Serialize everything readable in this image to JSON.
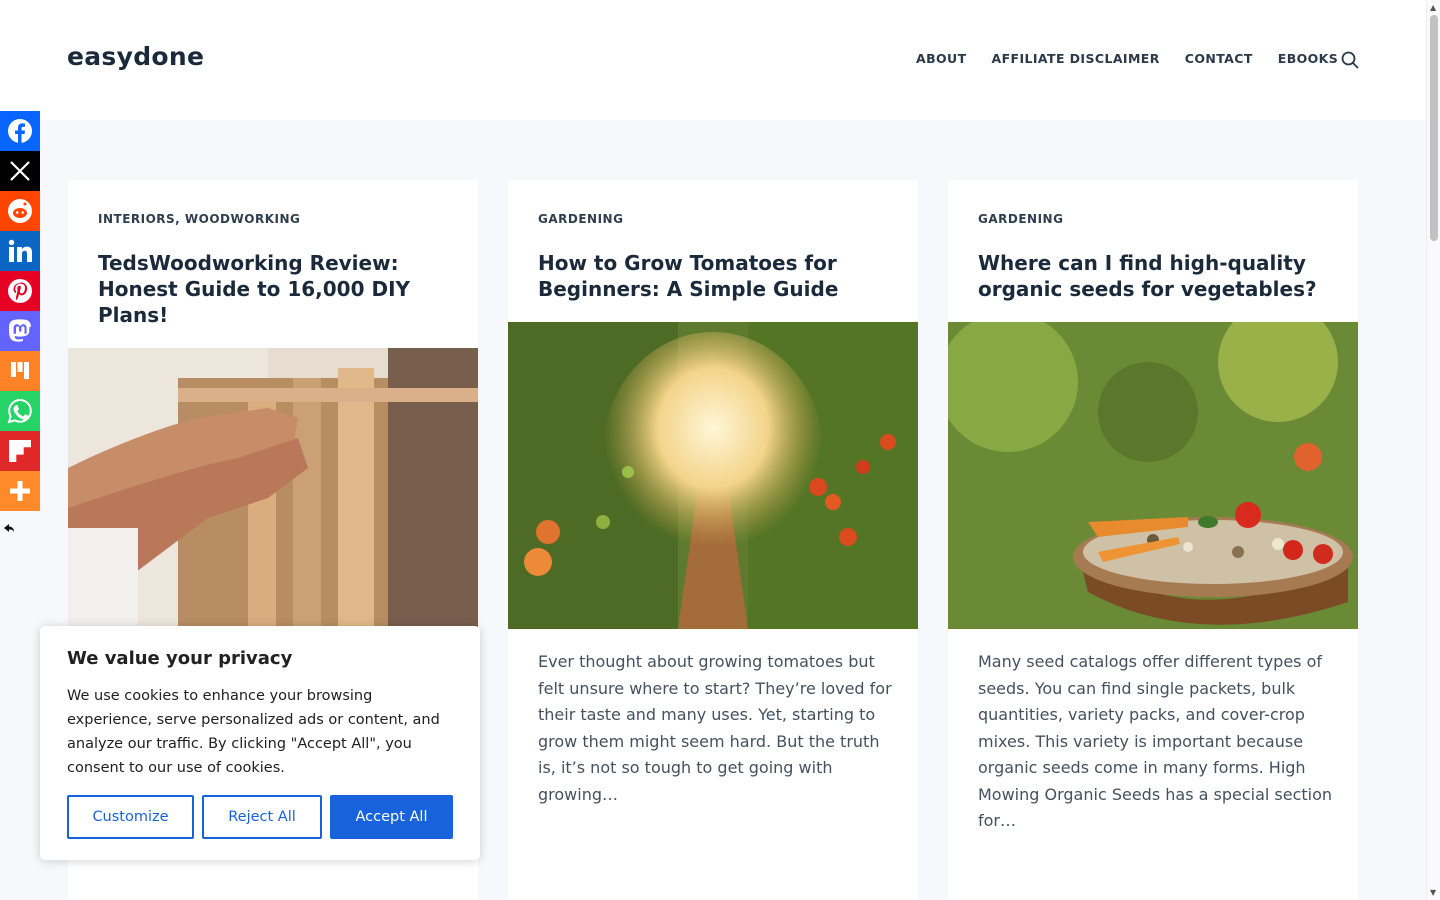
{
  "site": {
    "logo": "easydone"
  },
  "nav": {
    "items": [
      "ABOUT",
      "AFFILIATE DISCLAIMER",
      "CONTACT",
      "EBOOKS"
    ]
  },
  "social": {
    "items": [
      {
        "name": "facebook",
        "color": "#0866ff"
      },
      {
        "name": "x",
        "color": "#000000"
      },
      {
        "name": "reddit",
        "color": "#ff4500"
      },
      {
        "name": "linkedin",
        "color": "#0a66c2"
      },
      {
        "name": "pinterest",
        "color": "#e60023"
      },
      {
        "name": "mastodon",
        "color": "#6364ff"
      },
      {
        "name": "mix",
        "color": "#ff8226"
      },
      {
        "name": "whatsapp",
        "color": "#25d366"
      },
      {
        "name": "flipboard",
        "color": "#e12828"
      },
      {
        "name": "more",
        "color": "#ff8a2a"
      }
    ]
  },
  "cards": [
    {
      "category": "INTERIORS, WOODWORKING",
      "title": "TedsWoodworking Review: Honest Guide to 16,000 DIY Plans!",
      "excerpt": ""
    },
    {
      "category": "GARDENING",
      "title": "How to Grow Tomatoes for Beginners: A Simple Guide",
      "excerpt": "Ever thought about growing tomatoes but felt unsure where to start? They’re loved for their taste and many uses. Yet, starting to grow them might seem hard. But the truth is, it’s not so tough to get going with growing…"
    },
    {
      "category": "GARDENING",
      "title": "Where can I find high-quality organic seeds for vegetables?",
      "excerpt": "Many seed catalogs offer different types of seeds. You can find single packets, bulk quantities, variety packs, and cover-crop mixes. This variety is important because organic seeds come in many forms. High Mowing Organic Seeds has a special section for…"
    }
  ],
  "cookie": {
    "title": "We value your privacy",
    "text": "We use cookies to enhance your browsing experience, serve personalized ads or content, and analyze our traffic. By clicking \"Accept All\", you consent to our use of cookies.",
    "customize": "Customize",
    "reject": "Reject All",
    "accept": "Accept All"
  }
}
